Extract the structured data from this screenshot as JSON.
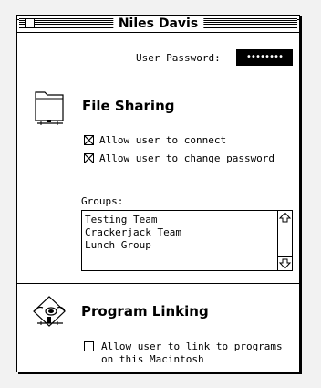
{
  "window": {
    "title": "Niles Davis"
  },
  "password": {
    "label": "User Password:",
    "value": "••••••••"
  },
  "file_sharing": {
    "title": "File Sharing",
    "icon": "folder-share-icon",
    "options": [
      {
        "label": "Allow user to connect",
        "checked": true
      },
      {
        "label": "Allow user to change password",
        "checked": true
      }
    ],
    "groups_label": "Groups:",
    "groups": [
      "Testing Team",
      "Crackerjack Team",
      "Lunch Group"
    ]
  },
  "program_linking": {
    "title": "Program Linking",
    "icon": "program-linking-icon",
    "option_line1": "Allow user to link to programs",
    "option_line2": "on this Macintosh",
    "checked": false
  }
}
